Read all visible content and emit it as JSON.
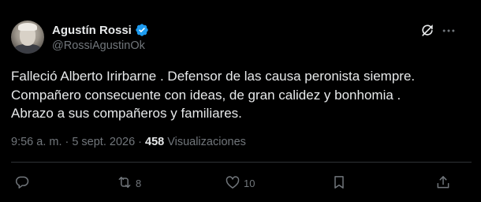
{
  "author": {
    "display_name": "Agustín Rossi",
    "handle": "@RossiAgustinOk"
  },
  "tweet": {
    "lines": [
      "Falleció Alberto Irirbarne . Defensor de las causa peronista siempre.",
      "Compañero consecuente con ideas, de gran calidez y bonhomia .",
      "Abrazo a sus compañeros y familiares."
    ],
    "time": "9:56 a. m.",
    "separator": "·",
    "date": "5 sept. 2026",
    "views_separator": "·",
    "views_count": "458",
    "views_label": "Visualizaciones"
  },
  "actions": {
    "reply_count": "",
    "retweet_count": "8",
    "like_count": "10"
  },
  "colors": {
    "background": "#000000",
    "text": "#e7e9ea",
    "muted": "#71767b",
    "verified": "#1d9bf0"
  },
  "icons": [
    "verified-icon",
    "grok-icon",
    "more-icon",
    "reply-icon",
    "retweet-icon",
    "like-icon",
    "bookmark-icon",
    "share-icon"
  ]
}
